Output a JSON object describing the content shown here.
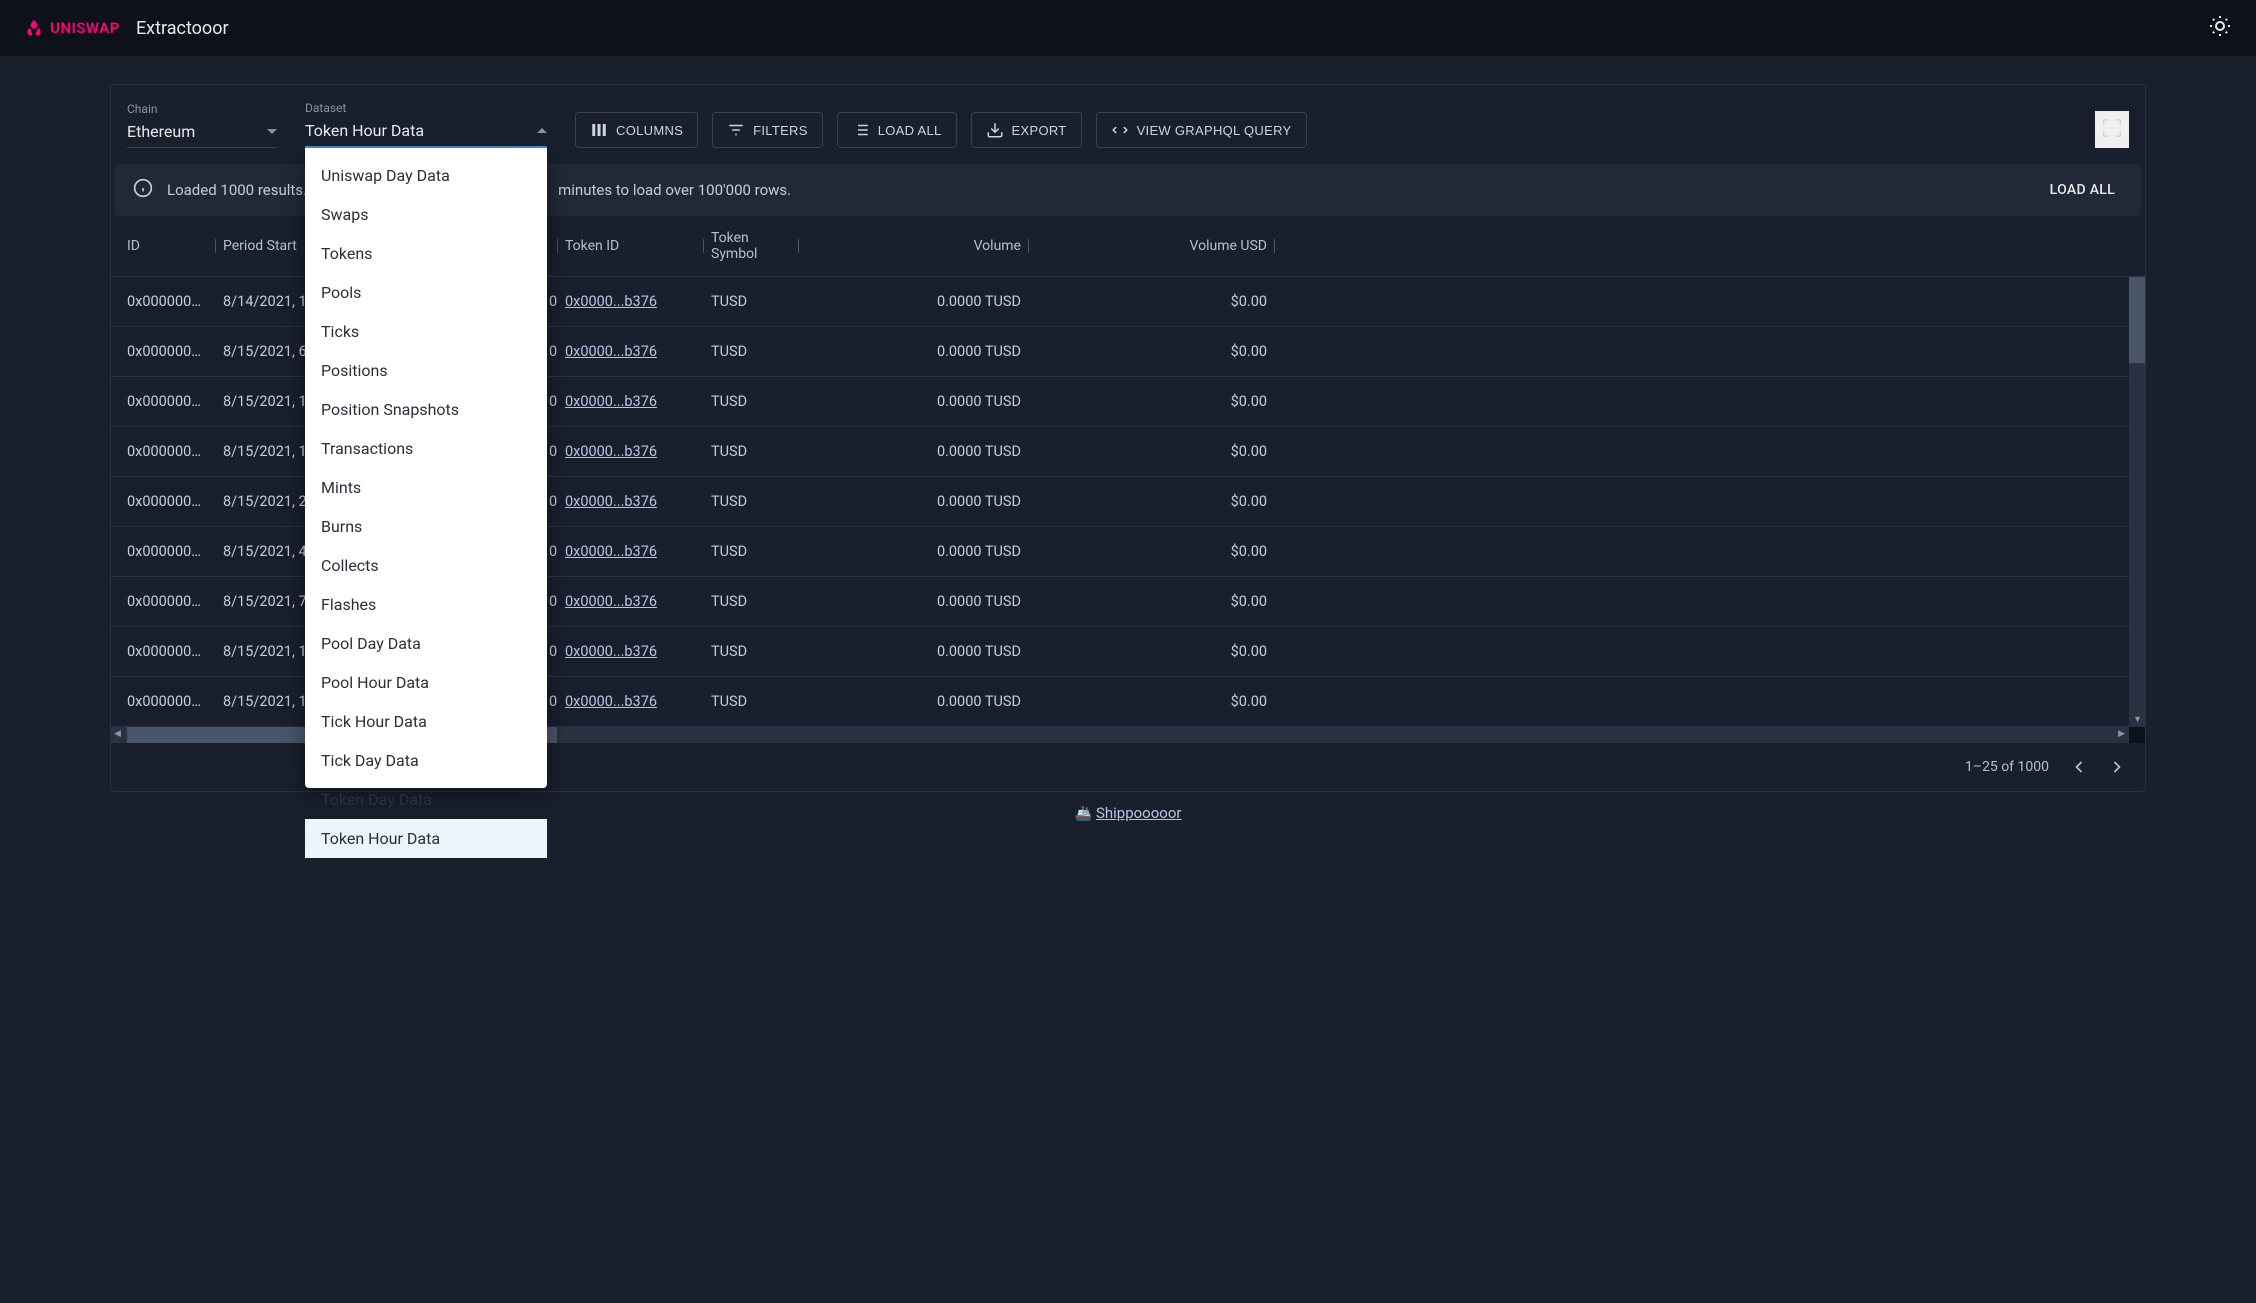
{
  "header": {
    "brand": "UNISWAP",
    "title": "Extractooor"
  },
  "controls": {
    "chain": {
      "label": "Chain",
      "value": "Ethereum"
    },
    "dataset": {
      "label": "Dataset",
      "value": "Token Hour Data",
      "options": [
        "Uniswap Day Data",
        "Swaps",
        "Tokens",
        "Pools",
        "Ticks",
        "Positions",
        "Position Snapshots",
        "Transactions",
        "Mints",
        "Burns",
        "Collects",
        "Flashes",
        "Pool Day Data",
        "Pool Hour Data",
        "Tick Hour Data",
        "Tick Day Data",
        "Token Day Data",
        "Token Hour Data"
      ]
    }
  },
  "toolbar": {
    "columns": "COLUMNS",
    "filters": "FILTERS",
    "load_all": "LOAD ALL",
    "export": "EXPORT",
    "view_query": "VIEW GRAPHQL QUERY"
  },
  "banner": {
    "message_prefix": "Loaded 1000 results.",
    "message_suffix": " minutes to load over 100'000 rows.",
    "action": "LOAD ALL"
  },
  "columns": [
    "ID",
    "Period Start",
    "Token ID",
    "Token Symbol",
    "Volume",
    "Volume USD"
  ],
  "rows": [
    {
      "id": "0x000000…",
      "period": "8/14/2021, 1",
      "fragment": "0",
      "token_id": "0x0000...b376",
      "symbol": "TUSD",
      "volume": "0.0000 TUSD",
      "volume_usd": "$0.00"
    },
    {
      "id": "0x000000…",
      "period": "8/15/2021, 6",
      "fragment": "0",
      "token_id": "0x0000...b376",
      "symbol": "TUSD",
      "volume": "0.0000 TUSD",
      "volume_usd": "$0.00"
    },
    {
      "id": "0x000000…",
      "period": "8/15/2021, 1",
      "fragment": "0",
      "token_id": "0x0000...b376",
      "symbol": "TUSD",
      "volume": "0.0000 TUSD",
      "volume_usd": "$0.00"
    },
    {
      "id": "0x000000…",
      "period": "8/15/2021, 1",
      "fragment": "0",
      "token_id": "0x0000...b376",
      "symbol": "TUSD",
      "volume": "0.0000 TUSD",
      "volume_usd": "$0.00"
    },
    {
      "id": "0x000000…",
      "period": "8/15/2021, 2",
      "fragment": "0",
      "token_id": "0x0000...b376",
      "symbol": "TUSD",
      "volume": "0.0000 TUSD",
      "volume_usd": "$0.00"
    },
    {
      "id": "0x000000…",
      "period": "8/15/2021, 4",
      "fragment": "0",
      "token_id": "0x0000...b376",
      "symbol": "TUSD",
      "volume": "0.0000 TUSD",
      "volume_usd": "$0.00"
    },
    {
      "id": "0x000000…",
      "period": "8/15/2021, 7",
      "fragment": "0",
      "token_id": "0x0000...b376",
      "symbol": "TUSD",
      "volume": "0.0000 TUSD",
      "volume_usd": "$0.00"
    },
    {
      "id": "0x000000…",
      "period": "8/15/2021, 1",
      "fragment": "0",
      "token_id": "0x0000...b376",
      "symbol": "TUSD",
      "volume": "0.0000 TUSD",
      "volume_usd": "$0.00"
    },
    {
      "id": "0x000000…",
      "period": "8/15/2021, 1",
      "fragment": "0",
      "token_id": "0x0000...b376",
      "symbol": "TUSD",
      "volume": "0.0000 TUSD",
      "volume_usd": "$0.00"
    }
  ],
  "pager": {
    "range": "1–25 of 1000"
  },
  "footer": {
    "link": "Shippooooor"
  }
}
